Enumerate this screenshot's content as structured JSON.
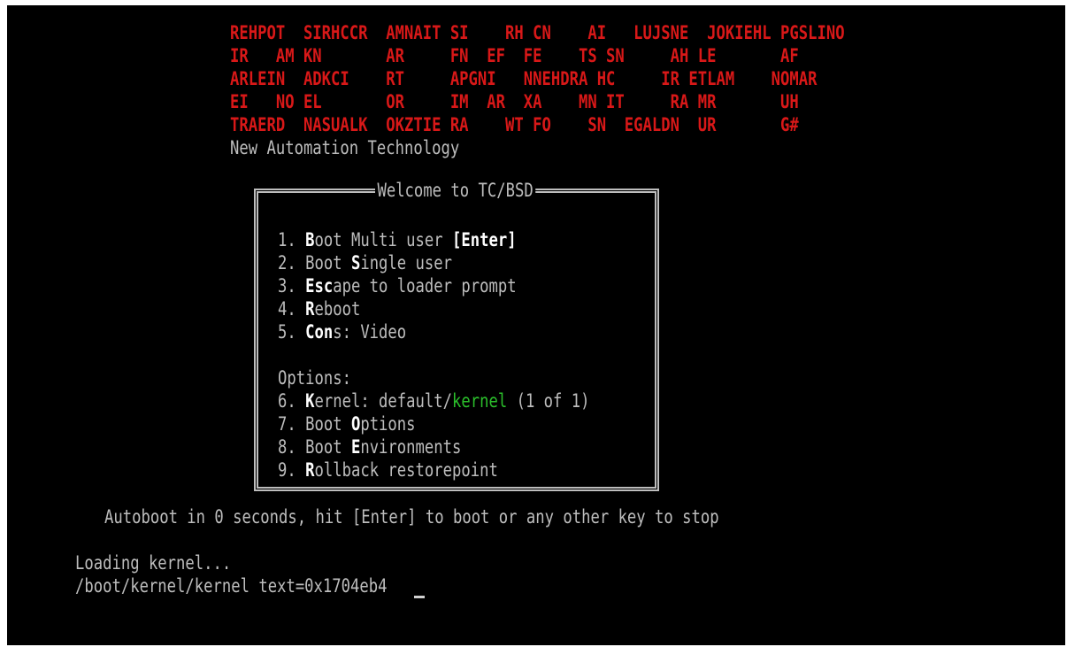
{
  "logo_rows": [
    "REHPOT  SIRHCCR  AMNAIT SI    RH CN    AI   LUJSNE  JOKIEHL PGSLINO",
    "IR   AM KN       AR     FN  EF  FE    TS SN     AH LE       AF",
    "ARLEIN  ADKCI    RT     APGNI   NNEHDRA HC     IR ETLAM    NOMAR",
    "EI   NO EL       OR     IM  AR  XA    MN IT     RA MR       UH",
    "TRAERD  NASUALK  OKZTIE RA    WT FO    SN  EGALDN  UR       G#"
  ],
  "tagline": "New Automation Technology",
  "menu": {
    "title": "Welcome to TC/BSD",
    "items": [
      {
        "num": "1. ",
        "hot": "B",
        "rest": "oot Multi user ",
        "suffix": "[Enter]"
      },
      {
        "num": "2. ",
        "pre": "Boot ",
        "hot": "S",
        "rest": "ingle user"
      },
      {
        "num": "3. ",
        "hot": "Esc",
        "rest": "ape to loader prompt"
      },
      {
        "num": "4. ",
        "hot": "R",
        "rest": "eboot"
      },
      {
        "num": "5. ",
        "hot": "Con",
        "rest": "s: Video"
      }
    ],
    "options_label": "Options:",
    "options": [
      {
        "num": "6. ",
        "hot": "K",
        "rest": "ernel: default/",
        "kernel": "kernel",
        "tail": " (1 of 1)"
      },
      {
        "num": "7. ",
        "pre": "Boot ",
        "hot": "O",
        "rest": "ptions"
      },
      {
        "num": "8. ",
        "pre": "Boot ",
        "hot": "E",
        "rest": "nvironments"
      },
      {
        "num": "9. ",
        "hot": "R",
        "rest": "ollback restorepoint"
      }
    ]
  },
  "autoboot": "Autoboot in 0 seconds, hit [Enter] to boot or any other key to stop",
  "loading": "Loading kernel...",
  "kernel_line": "/boot/kernel/kernel text=0x1704eb4"
}
